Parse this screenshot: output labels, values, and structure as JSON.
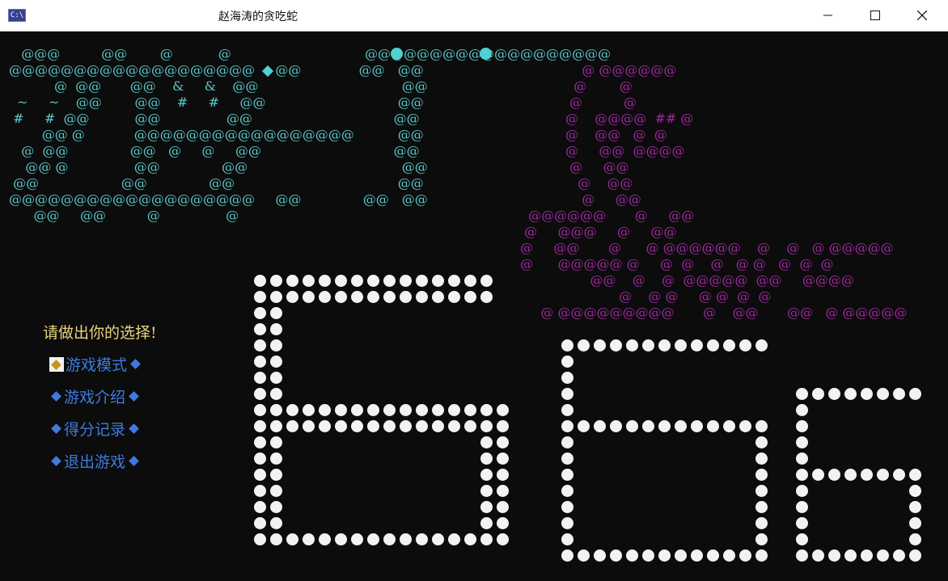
{
  "window": {
    "title": "赵海涛的贪吃蛇",
    "icon_text": "C:\\"
  },
  "ascii_title": "   @@@          @@        @           @      \n@@@@@@@@@@@@@@@@@@@     @@              @@   \n           @  @@       @@    &     &    @@   \n  ~     ~    @@        @@    #     #     @@  \n #     #  @@           @@                @@  \n        @@ @            @@@@@@@@@@@@@@@@@    \n   @  @@               @@   @     @     @@   \n    @@ @                @@               @@  \n @@                    @@               @@   \n@@@@@@@@@@@@@@@@@@@     @@               @@  \n      @@     @@          @                @  ",
  "ascii_title_t": "@@@@@@@@@@@@@@@@@@@\n        @@\n         @@\n        @@\n       @@\n        @@\n       @@\n         @@\n        @@\n         @@",
  "ascii_snake": "               @ @@@@@@\n             @        @\n            @          @\n           @    @@@@  ## @\n           @    @@   @  @\n           @     @@  @@@@\n            @     @@\n              @    @@\n               @     @@\n  @@@@@@       @     @@\n @     @@@     @     @@\n@     @@       @      @ @@@@@@    @    @   @ @@@@@\n@      @@@@@ @     @  @    @   @ @   @  @  @\n                 @@    @    @  @@@@@  @@     @@@@\n                        @    @ @     @ @  @  @\n     @ @@@@@@@@@       @    @@       @@   @ @@@@@",
  "menu": {
    "prompt": "请做出你的选择!",
    "items": [
      "游戏模式",
      "游戏介绍",
      "得分记录",
      "退出游戏"
    ],
    "selected_index": 0
  },
  "colors": {
    "ascii_title": "#5cc8c8",
    "ascii_snake": "#a02aa0",
    "menu_prompt": "#e8d47a",
    "menu_item": "#3e7be0",
    "selector": "#c9941c",
    "dot": "#f2f2f2"
  },
  "big_number": "666"
}
